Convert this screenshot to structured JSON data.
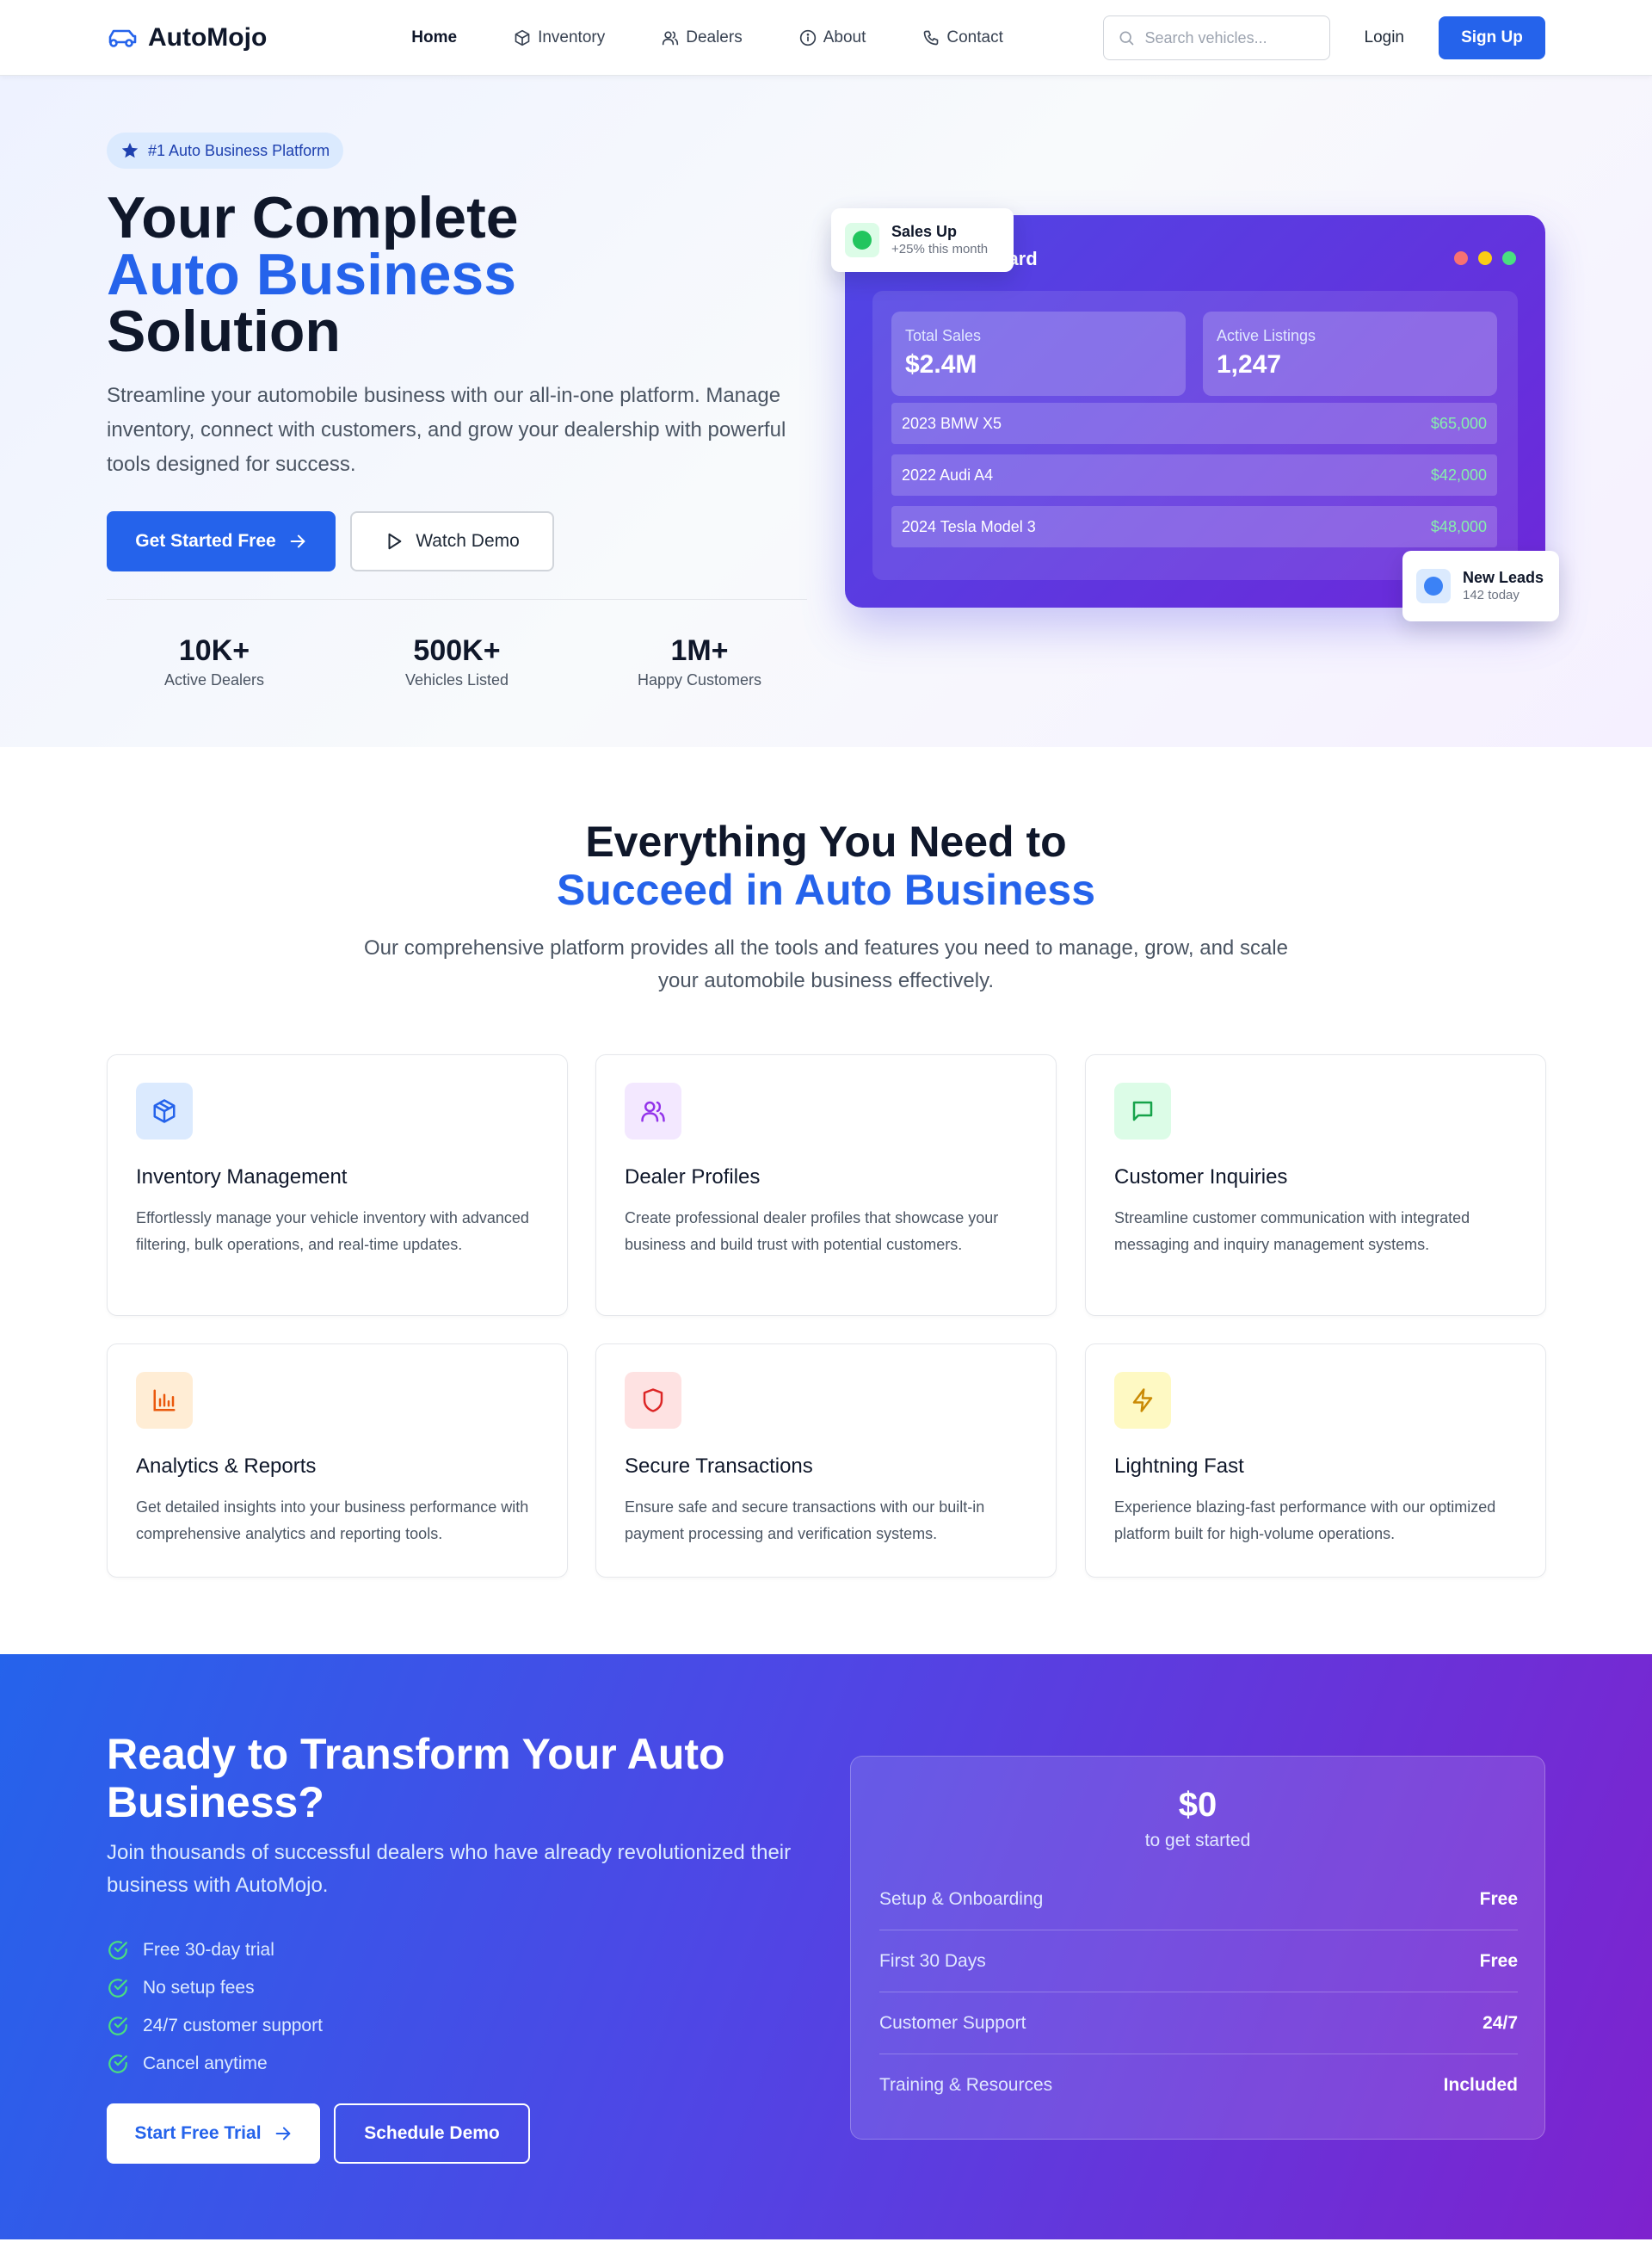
{
  "nav": {
    "logo": "AutoMojo",
    "links": [
      {
        "label": "Home"
      },
      {
        "label": "Inventory"
      },
      {
        "label": "Dealers"
      },
      {
        "label": "About"
      },
      {
        "label": "Contact"
      }
    ],
    "search_placeholder": "Search vehicles...",
    "login": "Login",
    "signup": "Sign Up",
    "brand_color": "#2563eb"
  },
  "hero": {
    "badge": "#1 Auto Business Platform",
    "title_line1": "Your Complete",
    "title_line2": "Auto Business",
    "title_line3": "Solution",
    "description": "Streamline your automobile business with our all-in-one platform. Manage inventory, connect with customers, and grow your dealership with powerful tools designed for success.",
    "primary_cta": "Get Started Free",
    "secondary_cta": "Watch Demo",
    "stats": [
      {
        "value": "10K+",
        "label": "Active Dealers"
      },
      {
        "value": "500K+",
        "label": "Vehicles Listed"
      },
      {
        "value": "1M+",
        "label": "Happy Customers"
      }
    ],
    "dashboard": {
      "title_visible": "oard",
      "dot_colors": [
        "#f87171",
        "#facc15",
        "#4ade80"
      ],
      "cards": [
        {
          "label": "Total Sales",
          "value": "$2.4M"
        },
        {
          "label": "Active Listings",
          "value": "1,247"
        }
      ],
      "rows": [
        {
          "name": "2023 BMW X5",
          "price": "$65,000"
        },
        {
          "name": "2022 Audi A4",
          "price": "$42,000"
        },
        {
          "name": "2024 Tesla Model 3",
          "price": "$48,000"
        }
      ]
    },
    "float_sales": {
      "title": "Sales Up",
      "sub": "+25% this month"
    },
    "float_leads": {
      "title": "New Leads",
      "sub": "142 today"
    }
  },
  "features": {
    "title_line1": "Everything You Need to",
    "title_line2": "Succeed in Auto Business",
    "description": "Our comprehensive platform provides all the tools and features you need to manage, grow, and scale your automobile business effectively.",
    "items": [
      {
        "icon": "box-icon",
        "title": "Inventory Management",
        "description": "Effortlessly manage your vehicle inventory with advanced filtering, bulk operations, and real-time updates."
      },
      {
        "icon": "users-icon",
        "title": "Dealer Profiles",
        "description": "Create professional dealer profiles that showcase your business and build trust with potential customers."
      },
      {
        "icon": "message-icon",
        "title": "Customer Inquiries",
        "description": "Streamline customer communication with integrated messaging and inquiry management systems."
      },
      {
        "icon": "chart-icon",
        "title": "Analytics & Reports",
        "description": "Get detailed insights into your business performance with comprehensive analytics and reporting tools."
      },
      {
        "icon": "shield-icon",
        "title": "Secure Transactions",
        "description": "Ensure safe and secure transactions with our built-in payment processing and verification systems."
      },
      {
        "icon": "lightning-icon",
        "title": "Lightning Fast",
        "description": "Experience blazing-fast performance with our optimized platform built for high-volume operations."
      }
    ]
  },
  "cta": {
    "title": "Ready to Transform Your Auto Business?",
    "description": "Join thousands of successful dealers who have already revolutionized their business with AutoMojo.",
    "benefits": [
      "Free 30-day trial",
      "No setup fees",
      "24/7 customer support",
      "Cancel anytime"
    ],
    "primary_button": "Start Free Trial",
    "secondary_button": "Schedule Demo",
    "pricing": {
      "price": "$0",
      "price_sub": "to get started",
      "rows": [
        {
          "label": "Setup & Onboarding",
          "value": "Free"
        },
        {
          "label": "First 30 Days",
          "value": "Free"
        },
        {
          "label": "Customer Support",
          "value": "24/7"
        },
        {
          "label": "Training & Resources",
          "value": "Included"
        }
      ]
    }
  }
}
